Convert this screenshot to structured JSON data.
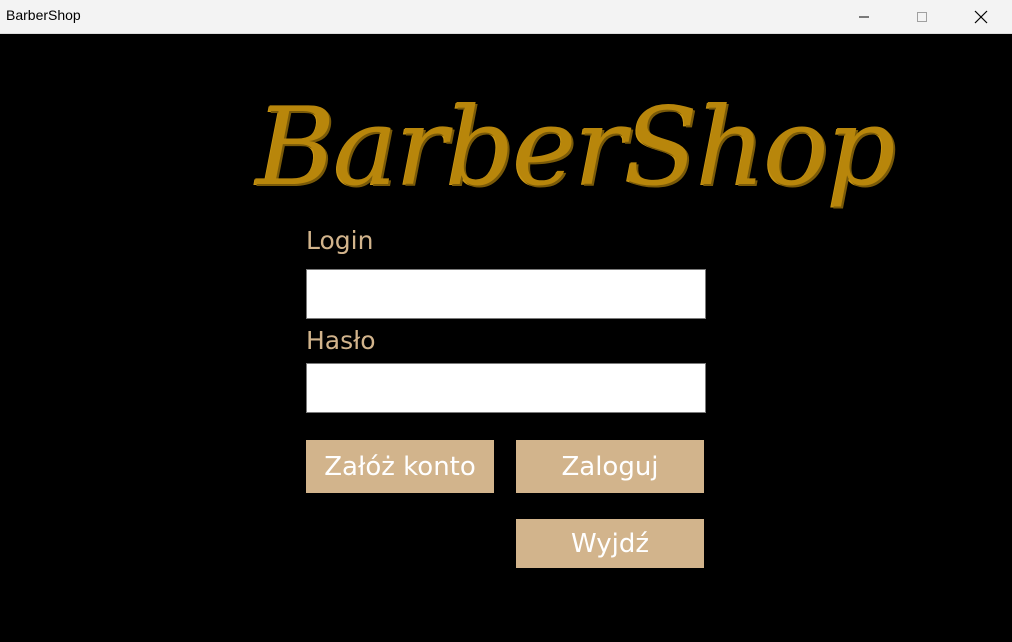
{
  "window": {
    "title": "BarberShop"
  },
  "logo": {
    "text": "BarberShop"
  },
  "form": {
    "login_label": "Login",
    "login_value": "",
    "password_label": "Hasło",
    "password_value": ""
  },
  "buttons": {
    "register_label": "Załóż konto",
    "login_label": "Zaloguj",
    "exit_label": "Wyjdź"
  },
  "colors": {
    "background": "#000000",
    "accent": "#d2b48c",
    "logo": "#b8860b",
    "button_text": "#ffffff"
  },
  "icons": {
    "minimize": "minimize-icon",
    "maximize": "maximize-icon",
    "close": "close-icon"
  }
}
